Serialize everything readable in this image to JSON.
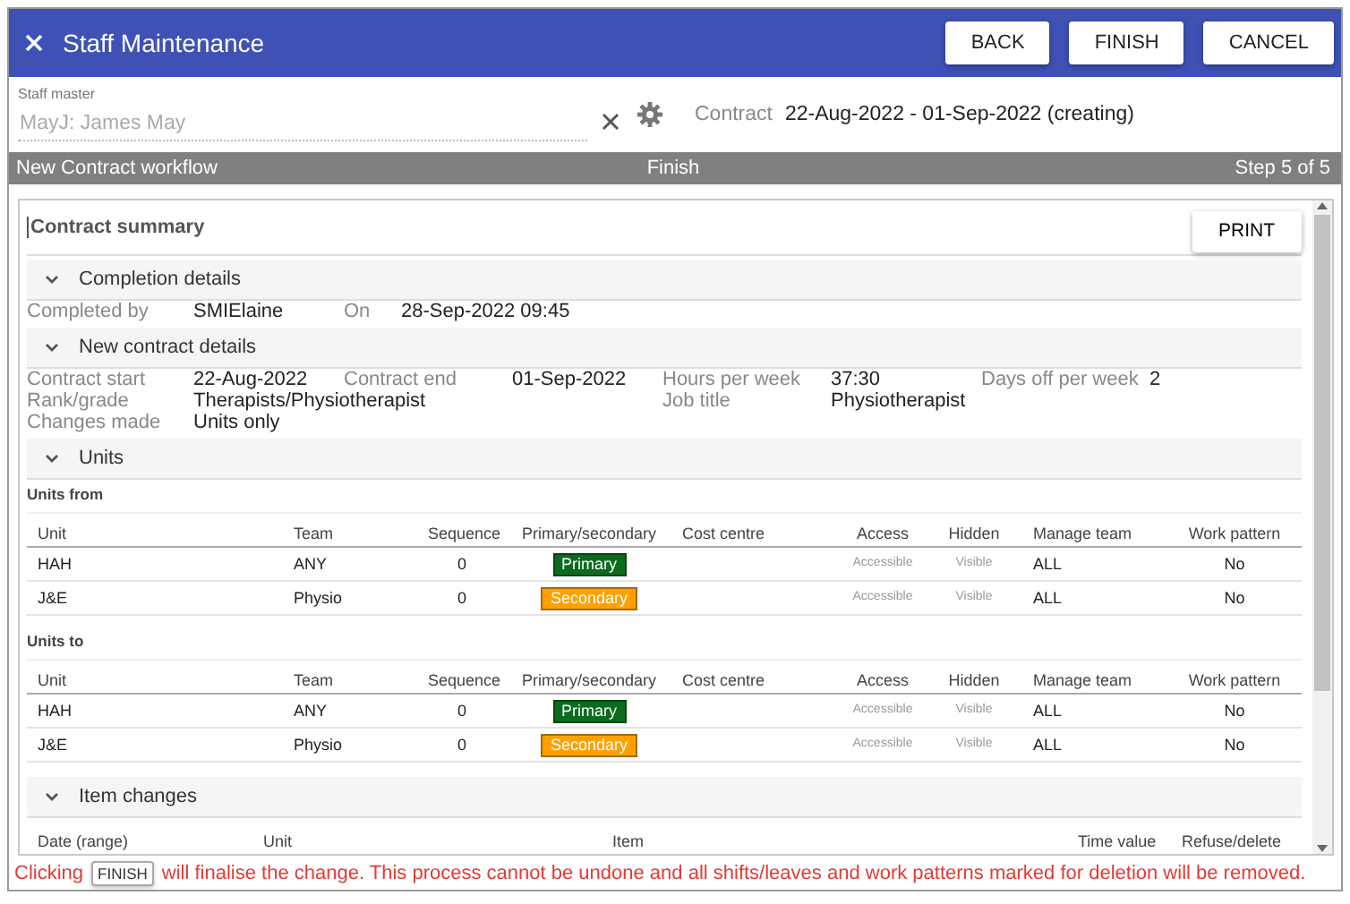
{
  "window": {
    "title": "Staff Maintenance"
  },
  "header_buttons": [
    "BACK",
    "FINISH",
    "CANCEL"
  ],
  "staff_master": {
    "label": "Staff master",
    "value": "MayJ: James May",
    "disabled": true
  },
  "contract": {
    "label": "Contract",
    "value": "22-Aug-2022 - 01-Sep-2022 (creating)"
  },
  "workflow_bar": {
    "name": "New Contract workflow",
    "step_title": "Finish",
    "step": "Step 5 of 5"
  },
  "summary": {
    "title": "Contract summary",
    "print_button": "PRINT",
    "sections": [
      {
        "kind": "completion",
        "title": "Completion details",
        "expanded": true,
        "fields": [
          {
            "label": "Completed by",
            "value": "SMIElaine"
          },
          {
            "label": "On",
            "value": "28-Sep-2022 09:45"
          }
        ]
      },
      {
        "kind": "details",
        "title": "New contract details",
        "expanded": true,
        "rows": [
          [
            {
              "label": "Contract start",
              "value": "22-Aug-2022"
            },
            {
              "label": "Contract end",
              "value": "01-Sep-2022"
            },
            {
              "label": "Hours per week",
              "value": "37:30"
            },
            {
              "label": "Days off per week",
              "value": "2"
            }
          ],
          [
            {
              "label": "Rank/grade",
              "value": "Therapists/Physiotherapist"
            },
            "",
            {
              "label": "Job title",
              "value": "Physiotherapist"
            }
          ],
          [
            {
              "label": "Changes made",
              "value": "Units only"
            }
          ]
        ]
      },
      {
        "kind": "units",
        "title": "Units",
        "expanded": true,
        "tables": [
          {
            "title": "Units from",
            "columns": [
              "Unit",
              "Team",
              "Sequence",
              "Primary/secondary",
              "Cost centre",
              "Access",
              "Hidden",
              "Manage team",
              "Work pattern"
            ],
            "rows": [
              {
                "unit": "HAH",
                "team": "ANY",
                "sequence": "0",
                "role": {
                  "label": "Primary",
                  "kind": "primary"
                },
                "access": "Accessible",
                "hidden": "Visible",
                "manage_team": "ALL",
                "work_pattern": "No"
              },
              {
                "unit": "J&E",
                "team": "Physio",
                "sequence": "0",
                "role": {
                  "label": "Secondary",
                  "kind": "secondary"
                },
                "access": "Accessible",
                "hidden": "Visible",
                "manage_team": "ALL",
                "work_pattern": "No"
              }
            ]
          },
          {
            "title": "Units to",
            "columns": [
              "Unit",
              "Team",
              "Sequence",
              "Primary/secondary",
              "Cost centre",
              "Access",
              "Hidden",
              "Manage team",
              "Work pattern"
            ],
            "rows": [
              {
                "unit": "HAH",
                "team": "ANY",
                "sequence": "0",
                "role": {
                  "label": "Primary",
                  "kind": "primary"
                },
                "access": "Accessible",
                "hidden": "Visible",
                "manage_team": "ALL",
                "work_pattern": "No"
              },
              {
                "unit": "J&E",
                "team": "Physio",
                "sequence": "0",
                "role": {
                  "label": "Secondary",
                  "kind": "secondary"
                },
                "access": "Accessible",
                "hidden": "Visible",
                "manage_team": "ALL",
                "work_pattern": "No"
              }
            ]
          }
        ]
      },
      {
        "kind": "item_changes",
        "title": "Item changes",
        "expanded": true,
        "columns": [
          "Date (range)",
          "Unit",
          "Item",
          "Time value",
          "Refuse/delete"
        ]
      }
    ]
  },
  "footer": {
    "before": "Clicking",
    "key": "FINISH",
    "after": "will finalise the change. This process cannot be undone and all shifts/leaves and work patterns marked for deletion will be removed."
  }
}
